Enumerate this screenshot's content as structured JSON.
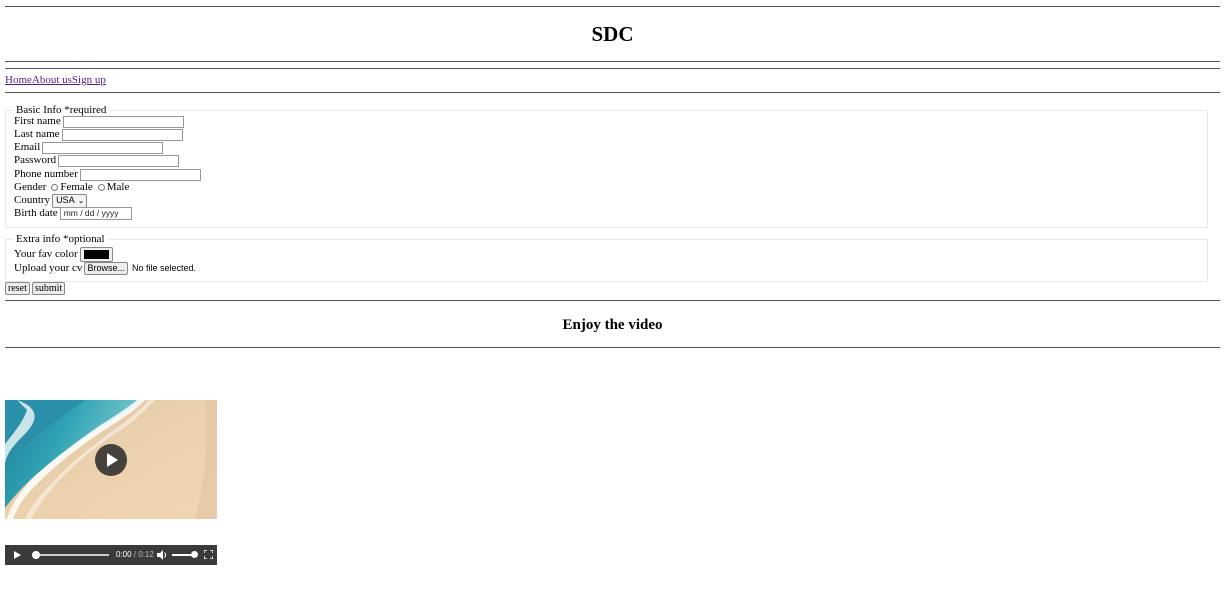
{
  "header": {
    "title": "SDC"
  },
  "nav": {
    "home": "Home",
    "about": "About us",
    "signup": "Sign up"
  },
  "basic_info": {
    "legend": "Basic Info *required",
    "first_name_label": "First name",
    "last_name_label": "Last name",
    "email_label": "Email",
    "password_label": "Password",
    "phone_label": "Phone number",
    "gender_label": "Gender",
    "gender_female": "Female",
    "gender_male": "Male",
    "country_label": "Country",
    "country_value": "USA",
    "birth_label": "Birth date",
    "birth_placeholder": "mm / dd / yyyy"
  },
  "extra_info": {
    "legend": "Extra info *optional",
    "color_label": "Your fav color",
    "color_value": "#000000",
    "cv_label": "Upload your cv",
    "browse_label": "Browse...",
    "file_status": "No file selected."
  },
  "form_buttons": {
    "reset": "reset",
    "submit": "submit"
  },
  "video_section": {
    "heading": "Enjoy the video",
    "current_time": "0:00",
    "separator": " / ",
    "duration": "0:12",
    "progress": 0,
    "volume": 1.0
  }
}
